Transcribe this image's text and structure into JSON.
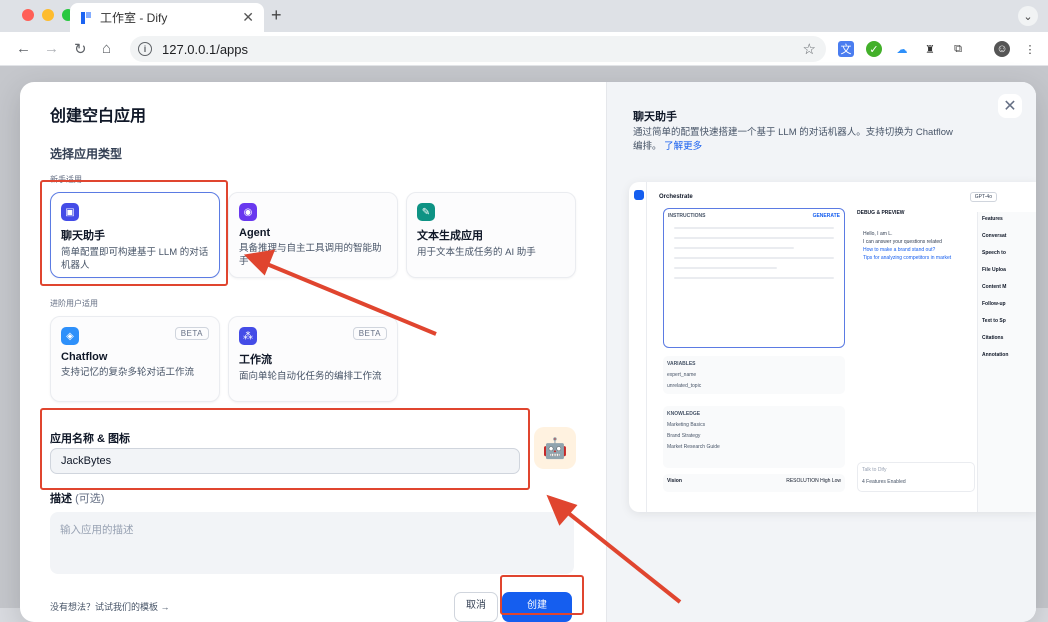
{
  "browser": {
    "tab_title": "工作室 - Dify",
    "url": "127.0.0.1/apps",
    "colors": {
      "close": "#ff5f57",
      "min": "#febc2e",
      "max": "#28c840"
    }
  },
  "left": {
    "title": "创建空白应用",
    "type_label": "选择应用类型",
    "group_beginner": "新手适用",
    "group_advanced": "进阶用户适用",
    "cards": [
      {
        "name": "聊天助手",
        "desc": "简单配置即可构建基于 LLM 的对话机器人",
        "icon": "chat-bot-icon",
        "color": "#444ce7"
      },
      {
        "name": "Agent",
        "desc": "具备推理与自主工具调用的智能助手",
        "icon": "agent-icon",
        "color": "#6938ef"
      },
      {
        "name": "文本生成应用",
        "desc": "用于文本生成任务的 AI 助手",
        "icon": "text-gen-icon",
        "color": "#0e9384"
      },
      {
        "name": "Chatflow",
        "desc": "支持记忆的复杂多轮对话工作流",
        "icon": "chatflow-icon",
        "color": "#2e90fa",
        "badge": "BETA"
      },
      {
        "name": "工作流",
        "desc": "面向单轮自动化任务的编排工作流",
        "icon": "workflow-icon",
        "color": "#444ce7",
        "badge": "BETA"
      }
    ],
    "name_label": "应用名称 & 图标",
    "name_value": "JackBytes",
    "desc_label": "描述",
    "desc_optional": "(可选)",
    "desc_placeholder": "输入应用的描述",
    "footer_link": "没有想法？试试我们的模板 →",
    "cancel": "取消",
    "create": "创建"
  },
  "right": {
    "title": "聊天助手",
    "desc": "通过简单的配置快速搭建一个基于 LLM 的对话机器人。支持切换为 Chatflow 编排。",
    "learn_more": "了解更多",
    "preview": {
      "heading": "Orchestrate",
      "model": "GPT-4o",
      "instructions": "INSTRUCTIONS",
      "generate": "GENERATE",
      "variables": "VARIABLES",
      "var1": "expert_name",
      "var2": "unrelated_topic",
      "knowledge": "KNOWLEDGE",
      "kn1": "Marketing Basics",
      "kn2": "Brand Strategy",
      "kn3": "Market Research Guide",
      "vision": "Vision",
      "resolution": "RESOLUTION",
      "high": "High",
      "low": "Low",
      "debug": "DEBUG & PREVIEW",
      "hello": "Hello, I am L.",
      "hello2": "I can answer your questions related",
      "q1": "How to make a brand stand out?",
      "q2": "Tips for analyzing competitors in market",
      "talk": "Talk to Dify",
      "features_enabled": "4 Features Enabled",
      "features": "Features",
      "f1": "Conversat",
      "f2": "Speech to",
      "f3": "File Uploa",
      "f4": "Content M",
      "f5": "Follow-up",
      "f6": "Text to Sp",
      "f7": "Citations",
      "f8": "Annotation"
    }
  }
}
